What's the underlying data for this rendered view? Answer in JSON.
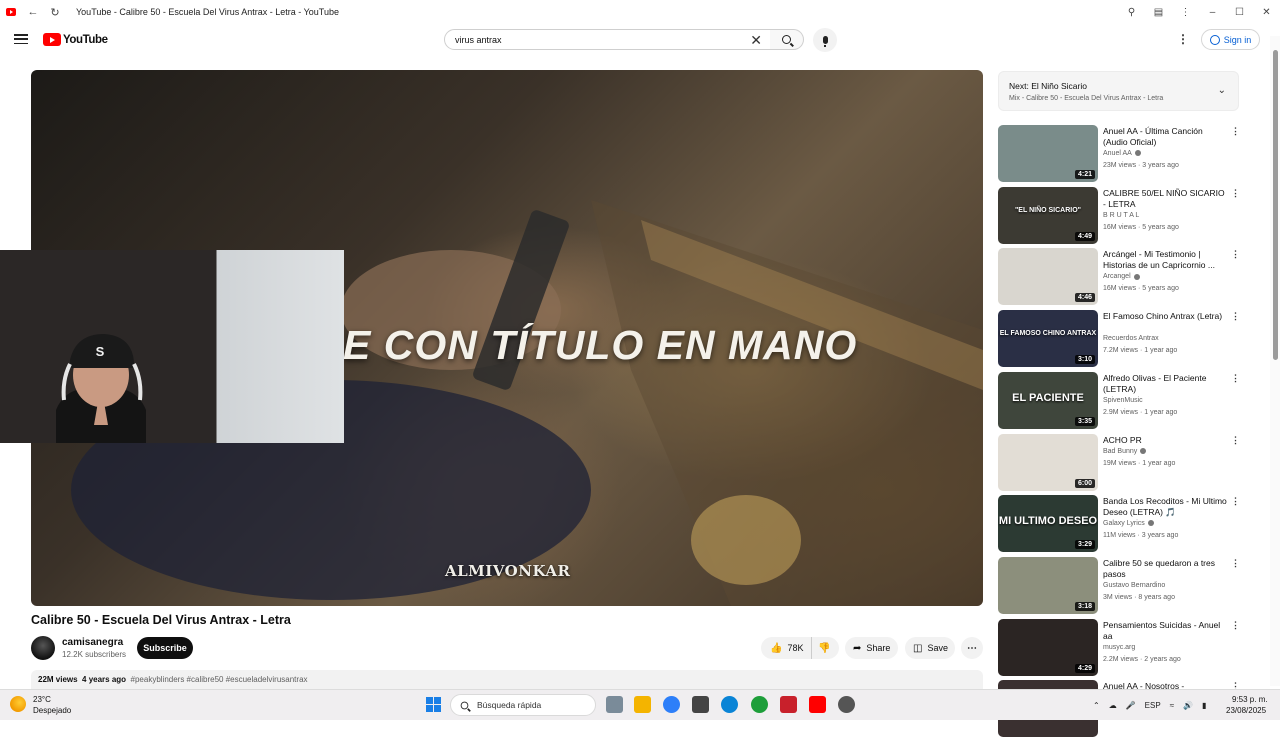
{
  "browser": {
    "window_title": "YouTube - Calibre 50 - Escuela Del Virus Antrax - Letra - YouTube"
  },
  "header": {
    "logo_text": "YouTube",
    "search_value": "virus antrax",
    "sign_in_label": "Sign in"
  },
  "player": {
    "lyric_text": "E CON TÍTULO EN MANO",
    "watermark": "ALMIVONKAR"
  },
  "video": {
    "title": "Calibre 50 - Escuela Del Virus Antrax - Letra",
    "channel": "camisanegra",
    "subscribers": "12.2K subscribers",
    "subscribe_label": "Subscribe",
    "likes": "78K",
    "share_label": "Share",
    "save_label": "Save",
    "views": "22M views",
    "age": "4 years ago",
    "tags": "#peakyblinders #calibre50 #escueladelvirusantrax"
  },
  "up_next": {
    "title": "Next: El Niño Sicario",
    "subtitle": "Mix - Calibre 50 - Escuela Del Virus Antrax - Letra"
  },
  "recommendations": [
    {
      "title": "Anuel AA - Última Canción (Audio Oficial)",
      "channel": "Anuel AA",
      "verified": true,
      "meta": "23M views · 3 years ago",
      "duration": "4:21",
      "color": "#7a8c8a",
      "thumb_text": ""
    },
    {
      "title": "CALIBRE 50/EL NIÑO SICARIO - LETRA",
      "channel": "B R U T A L",
      "verified": false,
      "meta": "16M views · 5 years ago",
      "duration": "4:49",
      "color": "#3c3a33",
      "thumb_text": "\"EL NIÑO SICARIO\""
    },
    {
      "title": "Arcángel - Mi Testimonio | Historias de un Capricornio ...",
      "channel": "Arcangel",
      "verified": true,
      "meta": "16M views · 5 years ago",
      "duration": "4:46",
      "color": "#d9d6cf",
      "thumb_text": ""
    },
    {
      "title": "El Famoso Chino Antrax (Letra)",
      "channel": "Recuerdos Antrax",
      "verified": false,
      "meta": "7.2M views · 1 year ago",
      "duration": "3:10",
      "color": "#2a2f45",
      "thumb_text": "EL FAMOSO CHINO ANTRAX"
    },
    {
      "title": "Alfredo Olivas - El Paciente (LETRA)",
      "channel": "SpivenMusic",
      "verified": false,
      "meta": "2.9M views · 1 year ago",
      "duration": "3:35",
      "color": "#3f463c",
      "thumb_text": "EL PACIENTE"
    },
    {
      "title": "ACHO PR",
      "channel": "Bad Bunny",
      "verified": true,
      "meta": "19M views · 1 year ago",
      "duration": "6:00",
      "color": "#e2ddd5",
      "thumb_text": ""
    },
    {
      "title": "Banda Los Recoditos - Mi Ultimo Deseo (LETRA) 🎵",
      "channel": "Galaxy Lyrics",
      "verified": true,
      "meta": "11M views · 3 years ago",
      "duration": "3:29",
      "color": "#2c3a33",
      "thumb_text": "MI ULTIMO DESEO"
    },
    {
      "title": "Calibre 50 se quedaron a tres pasos",
      "channel": "Gustavo Bernardino",
      "verified": false,
      "meta": "3M views · 8 years ago",
      "duration": "3:18",
      "color": "#8c8f7c",
      "thumb_text": ""
    },
    {
      "title": "Pensamientos Suicidas - Anuel aa",
      "channel": "musyc.arg",
      "verified": false,
      "meta": "2.2M views · 2 years ago",
      "duration": "4:29",
      "color": "#2b2523",
      "thumb_text": ""
    },
    {
      "title": "Anuel AA - Nosotros -",
      "channel": "",
      "verified": false,
      "meta": "",
      "duration": "",
      "color": "#3a3030",
      "thumb_text": ""
    }
  ],
  "taskbar": {
    "weather_temp": "23°C",
    "weather_desc": "Despejado",
    "search_placeholder": "Búsqueda rápida",
    "language": "ESP",
    "time": "9:53 p. m.",
    "date": "23/08/2025"
  },
  "colors": {
    "youtube_red": "#ff0000",
    "link_blue": "#065fd4"
  }
}
